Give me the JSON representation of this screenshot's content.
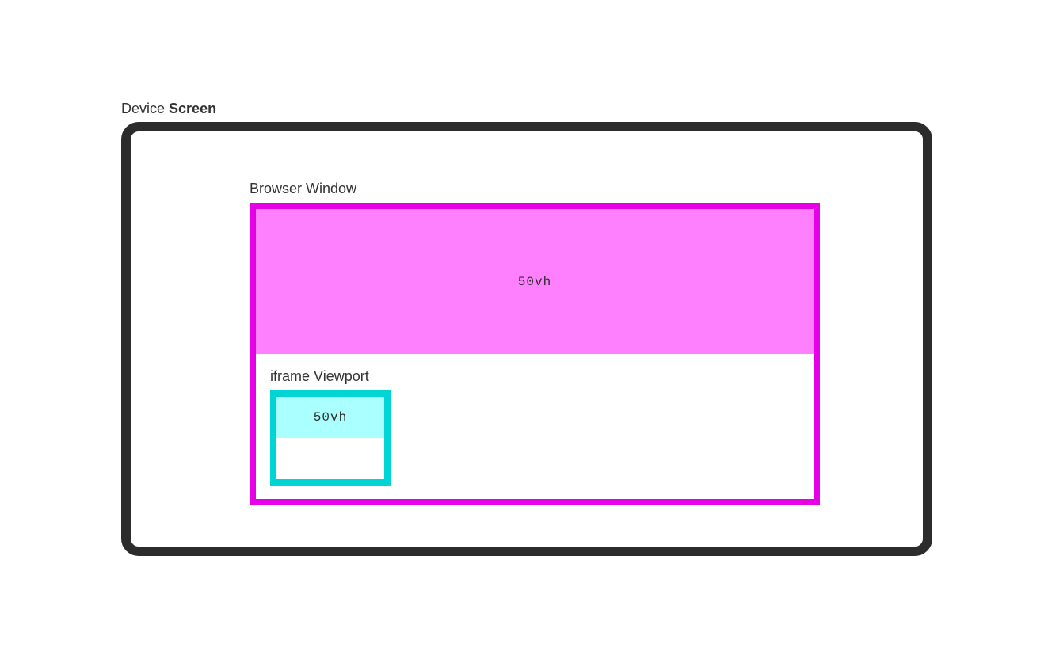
{
  "screen": {
    "label_prefix": "Device ",
    "label_bold": "Screen",
    "border_color": "#2c2c2c"
  },
  "browser": {
    "label_prefix": "Browser ",
    "label_bold": "Window",
    "border_color": "#e600e6",
    "top_half_color": "#ff80ff",
    "vh_text": "50vh"
  },
  "iframe": {
    "label_prefix": "iframe ",
    "label_bold": "Viewport",
    "border_color": "#00d4d4",
    "top_half_color": "#aaffff",
    "vh_text": "50vh"
  }
}
